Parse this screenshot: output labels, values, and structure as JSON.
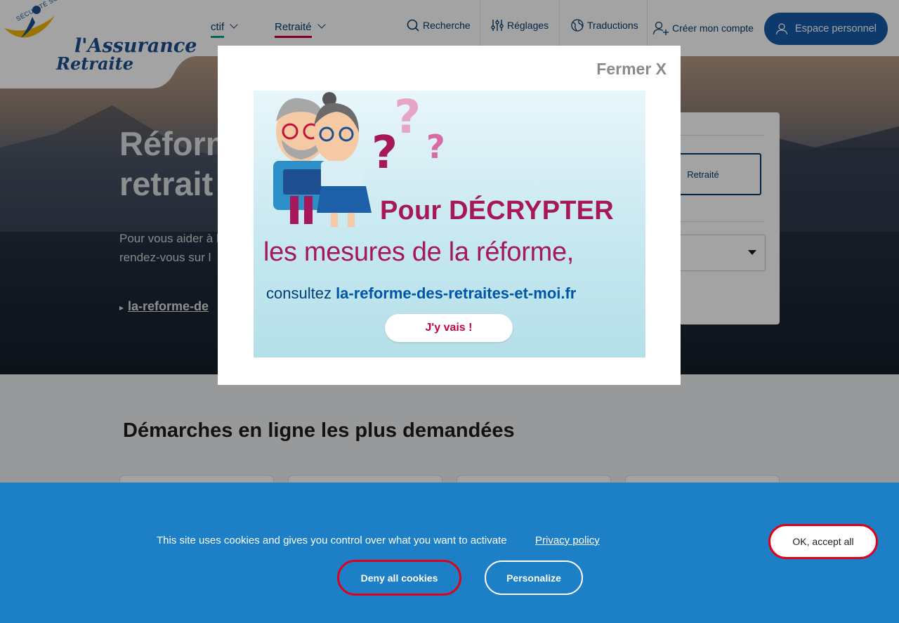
{
  "logo": {
    "seal_text": "SÉCURITÉ SOCIALE",
    "line1": "l'Assurance",
    "line2": "Retraite"
  },
  "nav": {
    "tabs": [
      {
        "label": "Actif"
      },
      {
        "label": "Retraité"
      }
    ]
  },
  "utility": {
    "search": "Recherche",
    "settings": "Réglages",
    "translations": "Traductions",
    "create_account": "Créer mon compte",
    "personal_space": "Espace personnel"
  },
  "hero": {
    "title_line1": "Réform",
    "title_line2": "retrait",
    "text": "Pour vous aider à les potentielles in rendez-vous sur l",
    "link": "la-reforme-de"
  },
  "panel": {
    "selected_tab": "Retraité"
  },
  "main": {
    "section_title": "Démarches en ligne les plus demandées"
  },
  "modal": {
    "close_label": "Fermer X",
    "promo": {
      "line1": "Pour DÉCRYPTER",
      "line2": "les mesures de la réforme,",
      "line3_prefix": "consultez ",
      "line3_url": "la-reforme-des-retraites-et-moi.fr",
      "button": "J'y vais !"
    }
  },
  "cookies": {
    "text": "This site uses cookies and gives you control over what you want to activate",
    "privacy_link": "Privacy policy",
    "accept_all": "OK, accept all",
    "deny_all": "Deny all cookies",
    "personalize": "Personalize"
  },
  "colors": {
    "brand_blue": "#155aa8",
    "cookie_bg": "#1d80c7",
    "accent_red": "#e1001a",
    "actif_underline": "#00a19a",
    "retraite_underline": "#c6003d",
    "promo_magenta": "#a6185a"
  },
  "icons": [
    "search-icon",
    "settings-sliders-icon",
    "globe-icon",
    "user-plus-icon",
    "user-icon",
    "chevron-down-icon",
    "triangle-right-icon",
    "caret-down-icon"
  ]
}
